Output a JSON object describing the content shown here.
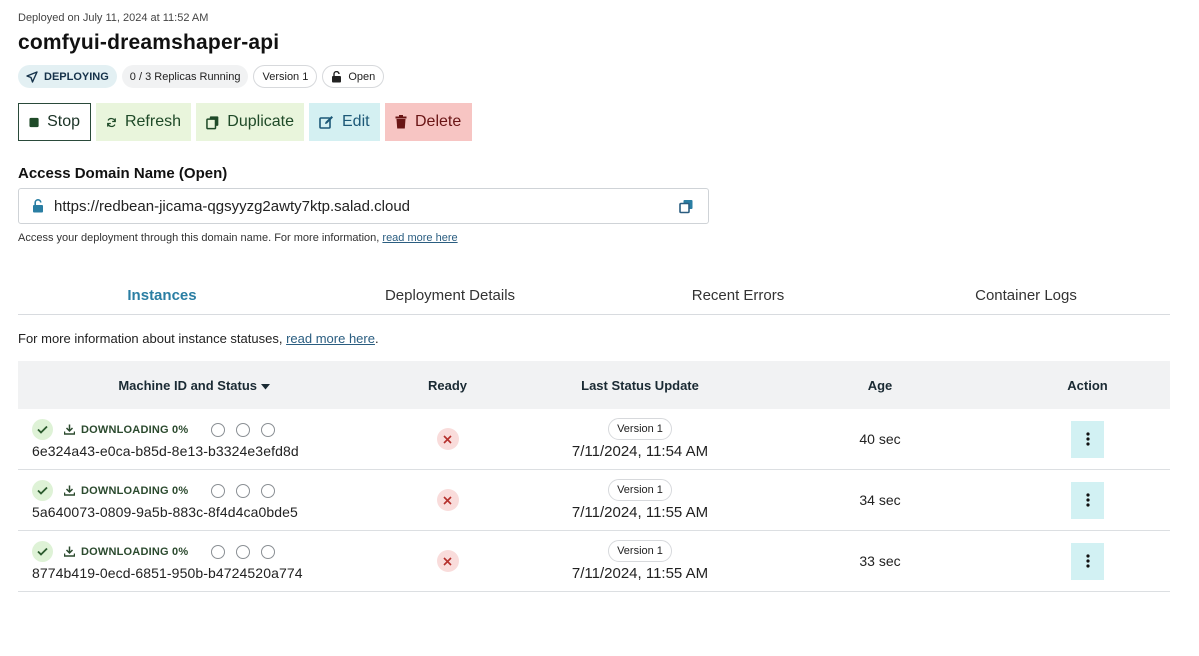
{
  "header": {
    "deployed_text": "Deployed on July 11, 2024 at 11:52 AM",
    "title": "comfyui-dreamshaper-api"
  },
  "badges": {
    "status": "DEPLOYING",
    "replicas": "0 / 3 Replicas Running",
    "version": "Version 1",
    "access": "Open"
  },
  "actions": {
    "stop": "Stop",
    "refresh": "Refresh",
    "duplicate": "Duplicate",
    "edit": "Edit",
    "delete": "Delete"
  },
  "access": {
    "label": "Access Domain Name (Open)",
    "url": "https://redbean-jicama-qgsyyzg2awty7ktp.salad.cloud",
    "help_prefix": "Access your deployment through this domain name. For more information, ",
    "help_link": "read more here"
  },
  "tabs": [
    {
      "label": "Instances",
      "active": true
    },
    {
      "label": "Deployment Details",
      "active": false
    },
    {
      "label": "Recent Errors",
      "active": false
    },
    {
      "label": "Container Logs",
      "active": false
    }
  ],
  "info": {
    "prefix": "For more information about instance statuses, ",
    "link": "read more here",
    "suffix": "."
  },
  "table": {
    "headers": {
      "machine": "Machine ID and Status",
      "ready": "Ready",
      "last_update": "Last Status Update",
      "age": "Age",
      "action": "Action"
    },
    "rows": [
      {
        "status": "DOWNLOADING 0%",
        "machine_id": "6e324a43-e0ca-b85d-8e13-b3324e3efd8d",
        "version": "Version 1",
        "updated": "7/11/2024, 11:54 AM",
        "age": "40 sec"
      },
      {
        "status": "DOWNLOADING 0%",
        "machine_id": "5a640073-0809-9a5b-883c-8f4d4ca0bde5",
        "version": "Version 1",
        "updated": "7/11/2024, 11:55 AM",
        "age": "34 sec"
      },
      {
        "status": "DOWNLOADING 0%",
        "machine_id": "8774b419-0ecd-6851-950b-b4724520a774",
        "version": "Version 1",
        "updated": "7/11/2024, 11:55 AM",
        "age": "33 sec"
      }
    ]
  },
  "colors": {
    "accent": "#2a7ea3",
    "link": "#2a5d80",
    "success_bg": "#def2d6",
    "error_bg": "#f9dcdb",
    "action_bg": "#d2f1f3"
  }
}
